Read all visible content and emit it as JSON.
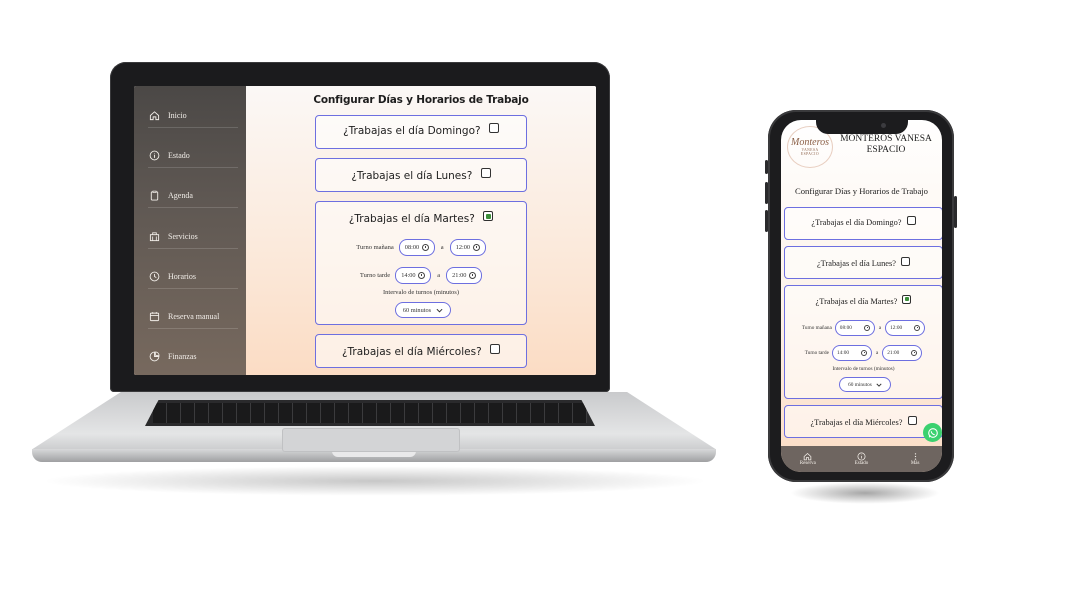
{
  "laptop": {
    "sidebar": {
      "items": [
        {
          "label": "Inicio",
          "icon": "home-icon"
        },
        {
          "label": "Estado",
          "icon": "info-icon"
        },
        {
          "label": "Agenda",
          "icon": "clipboard-icon"
        },
        {
          "label": "Servicios",
          "icon": "building-icon"
        },
        {
          "label": "Horarios",
          "icon": "clock-icon"
        },
        {
          "label": "Reserva manual",
          "icon": "calendar-icon"
        },
        {
          "label": "Finanzas",
          "icon": "pie-chart-icon"
        }
      ]
    },
    "main": {
      "title": "Configurar Días y Horarios de Trabajo",
      "days": [
        {
          "question": "¿Trabajas el día Domingo?",
          "checked": false
        },
        {
          "question": "¿Trabajas el día Lunes?",
          "checked": false
        },
        {
          "question": "¿Trabajas el día Martes?",
          "checked": true,
          "morning_label": "Turno mañana",
          "morning_from": "08:00",
          "morning_to": "12:00",
          "afternoon_label": "Turno tarde",
          "afternoon_from": "14:00",
          "afternoon_to": "21:00",
          "separator": "a",
          "interval_label": "Intervalo de turnos (minutos)",
          "interval_value": "60 minutos"
        },
        {
          "question": "¿Trabajas el día Miércoles?",
          "checked": false
        }
      ]
    }
  },
  "phone": {
    "brand": {
      "logo_text": "Monteros",
      "logo_sub1": "VANESA",
      "logo_sub2": "ESPACIO",
      "name": "MONTEROS VANESA ESPACIO"
    },
    "title": "Configurar Días y Horarios de Trabajo",
    "days": [
      {
        "question": "¿Trabajas el día Domingo?",
        "checked": false
      },
      {
        "question": "¿Trabajas el día Lunes?",
        "checked": false
      },
      {
        "question": "¿Trabajas el día Martes?",
        "checked": true,
        "morning_label": "Turno mañana",
        "morning_from": "08:00",
        "morning_to": "12:00",
        "afternoon_label": "Turno tarde",
        "afternoon_from": "14:00",
        "afternoon_to": "21:00",
        "separator": "a",
        "interval_label": "Intervalo de turnos (minutos)",
        "interval_value": "60 minutos"
      },
      {
        "question": "¿Trabajas el día Miércoles?",
        "checked": false
      }
    ],
    "bottom_nav": [
      {
        "label": "Reserva",
        "icon": "home-icon"
      },
      {
        "label": "Estado",
        "icon": "info-icon"
      },
      {
        "label": "Más",
        "icon": "more-vertical-icon"
      }
    ]
  },
  "colors": {
    "accent": "#6d6fe0",
    "checkbox_on": "#3c8f3a",
    "whatsapp": "#3bd16f",
    "sidebar": "#5f5853"
  }
}
